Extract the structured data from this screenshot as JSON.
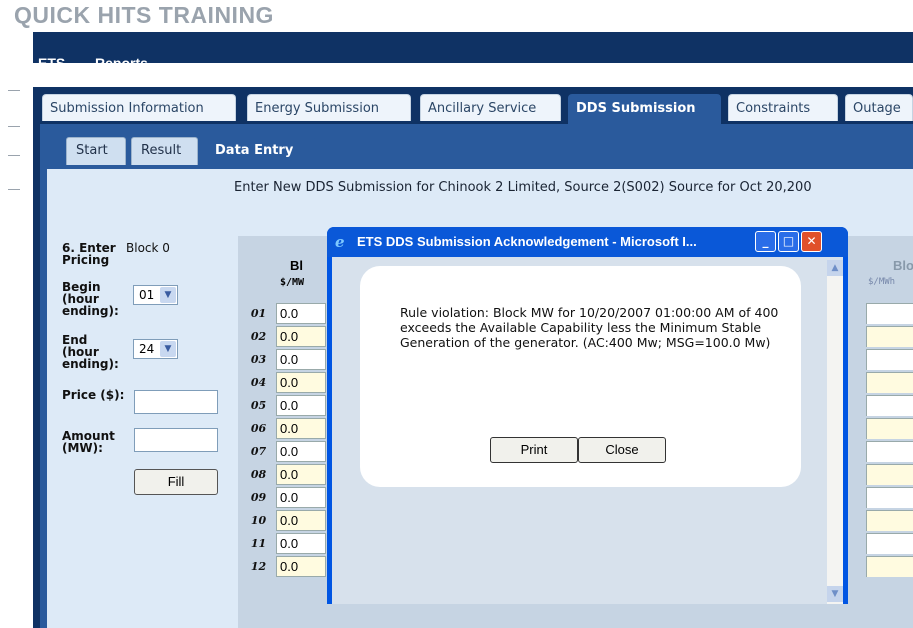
{
  "banner": "QUICK HITS TRAINING",
  "nav": {
    "ets": "ETS",
    "reports": "Reports"
  },
  "tabs": [
    "Submission Information",
    "Energy Submission",
    "Ancillary Service",
    "DDS Submission",
    "Constraints",
    "Outage"
  ],
  "active_tab": "DDS Submission",
  "subtabs": [
    "Start",
    "Result",
    "Data Entry"
  ],
  "active_subtab": "Data Entry",
  "subtitle": "Enter New DDS Submission for Chinook 2 Limited, Source 2(S002) Source for Oct 20,200",
  "form": {
    "section_label": "6. Enter Pricing",
    "block_label": "Block 0",
    "begin_label": "Begin (hour ending):",
    "begin_value": "01",
    "end_label": "End (hour ending):",
    "end_value": "24",
    "price_label": "Price ($):",
    "amount_label": "Amount (MW):",
    "fill_button": "Fill"
  },
  "grid": {
    "header_fragment": "Bl",
    "unit_fragment": "$/MW",
    "right_header_fragment": "Blo",
    "right_unit_fragment": "$/MWh",
    "rows": [
      {
        "label": "01",
        "value": "0.0"
      },
      {
        "label": "02",
        "value": "0.0"
      },
      {
        "label": "03",
        "value": "0.0"
      },
      {
        "label": "04",
        "value": "0.0"
      },
      {
        "label": "05",
        "value": "0.0"
      },
      {
        "label": "06",
        "value": "0.0"
      },
      {
        "label": "07",
        "value": "0.0"
      },
      {
        "label": "08",
        "value": "0.0"
      },
      {
        "label": "09",
        "value": "0.0"
      },
      {
        "label": "10",
        "value": "0.0"
      },
      {
        "label": "11",
        "value": "0.0"
      },
      {
        "label": "12",
        "value": "0.0"
      }
    ]
  },
  "popup": {
    "title": "ETS DDS Submission Acknowledgement - Microsoft I...",
    "message": "Rule violation: Block MW for 10/20/2007 01:00:00 AM of 400 exceeds the Available Capability less the Minimum Stable Generation of the generator. (AC:400 Mw; MSG=100.0 Mw)",
    "print_button": "Print",
    "close_button": "Close"
  },
  "colors": {
    "navy": "#0f3264",
    "panel_blue": "#2a5a9c",
    "content_bg": "#ddeaf7",
    "xp_title_blue": "#0055e3",
    "row_alt": "#fffbe0"
  }
}
